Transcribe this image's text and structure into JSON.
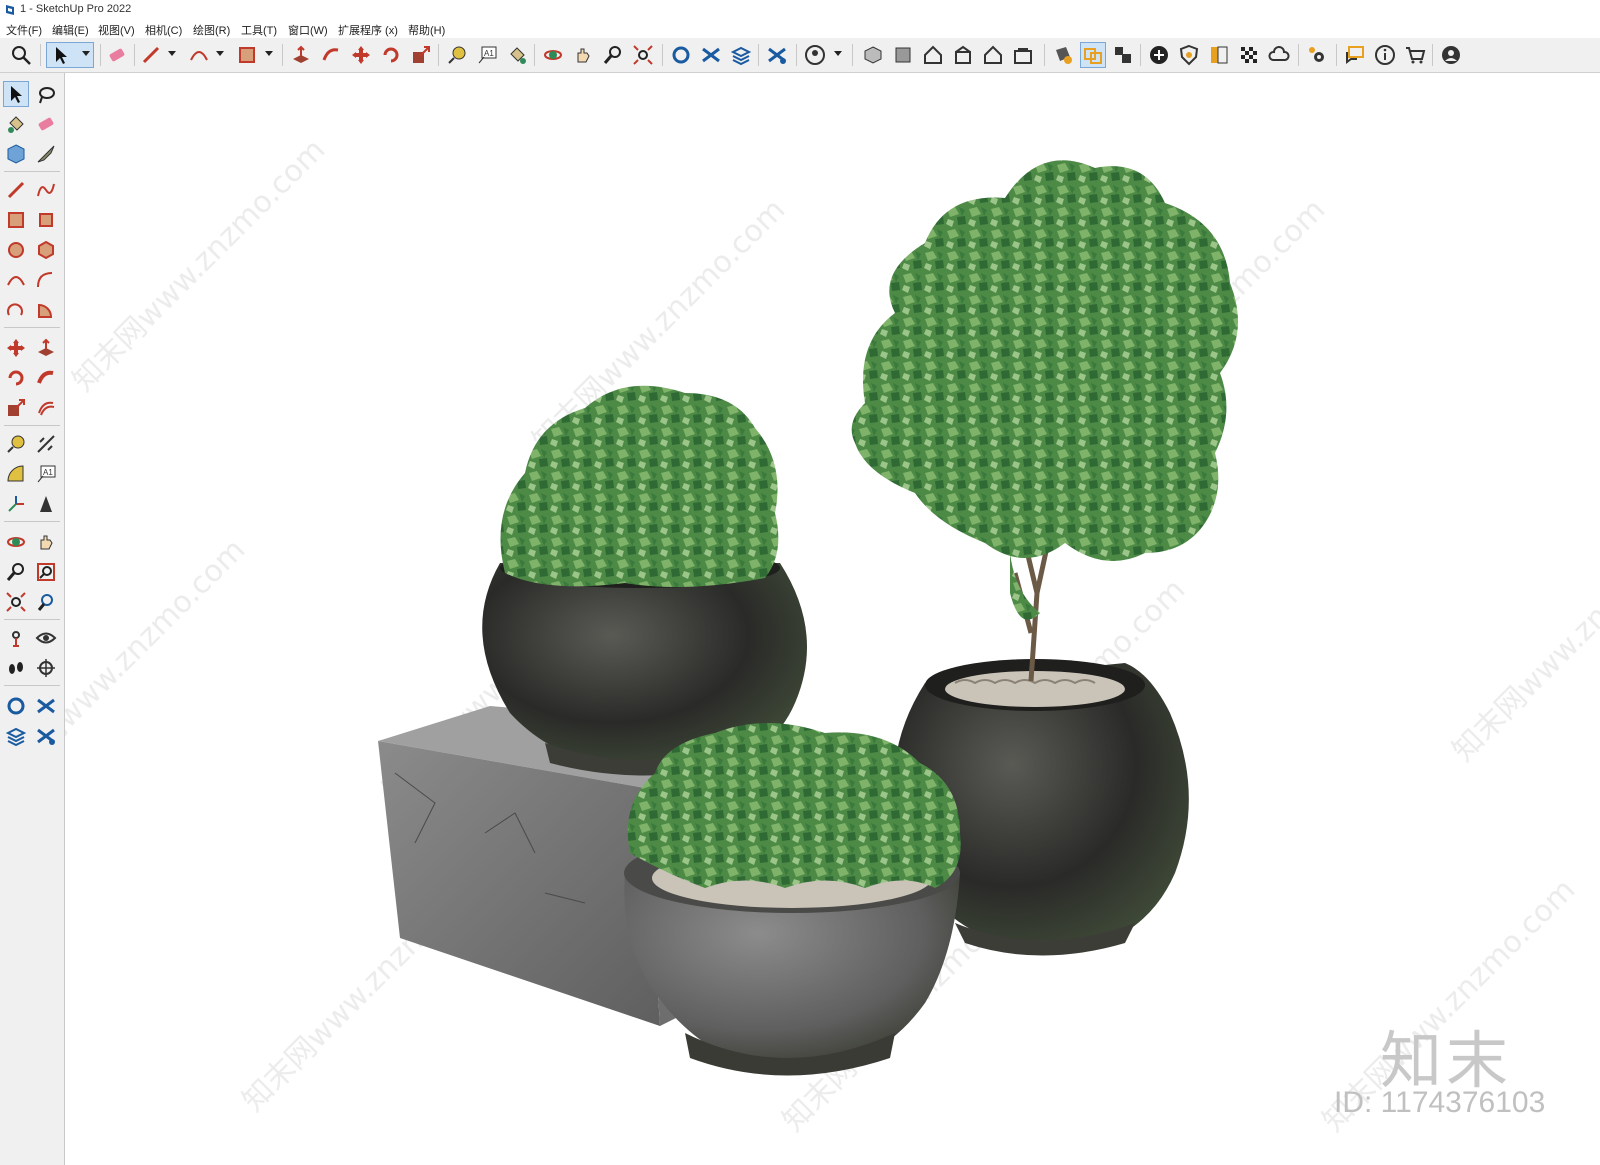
{
  "window": {
    "title": "1 - SketchUp Pro 2022"
  },
  "menu": [
    "文件(F)",
    "编辑(E)",
    "视图(V)",
    "相机(C)",
    "绘图(R)",
    "工具(T)",
    "窗口(W)",
    "扩展程序 (x)",
    "帮助(H)"
  ],
  "toolbar": {
    "label_tool_text": "A1",
    "icons": [
      "search-icon",
      "select-icon",
      "eraser-icon",
      "pencil-icon",
      "arc-icon",
      "rectangle-icon",
      "push-pull-icon",
      "follow-me-icon",
      "move-icon",
      "rotate-icon",
      "scale-icon",
      "tape-measure-icon",
      "text-icon",
      "paint-bucket-icon",
      "orbit-icon",
      "pan-icon",
      "zoom-icon",
      "zoom-extents-icon",
      "warehouse-icon",
      "extension-warehouse-icon",
      "layout-icon",
      "extension-manager-icon",
      "account-icon",
      "iso-view-icon",
      "front-view-icon",
      "top-view-icon",
      "right-view-icon",
      "back-view-icon",
      "left-view-icon",
      "section-icon",
      "section-display-icon",
      "section-fill-icon",
      "add-location-icon",
      "shield-icon",
      "styles-icon",
      "pattern-icon",
      "cloud-icon",
      "settings-icon",
      "chat-icon",
      "info-icon",
      "cart-icon",
      "user-icon"
    ]
  },
  "left_toolbar": {
    "label_tool_text": "A1"
  },
  "watermark": {
    "logo_text": "知末",
    "id_text": "ID: 1174376103",
    "diagonal_text": "知末网www.znzmo.com"
  },
  "colors": {
    "toolbar_bg": "#f0f0f0",
    "accent_active": "#cfe3f7",
    "foliage": "#4e8a48",
    "pot_dark": "#2b2b2b",
    "stone": "#8a8a8a"
  }
}
